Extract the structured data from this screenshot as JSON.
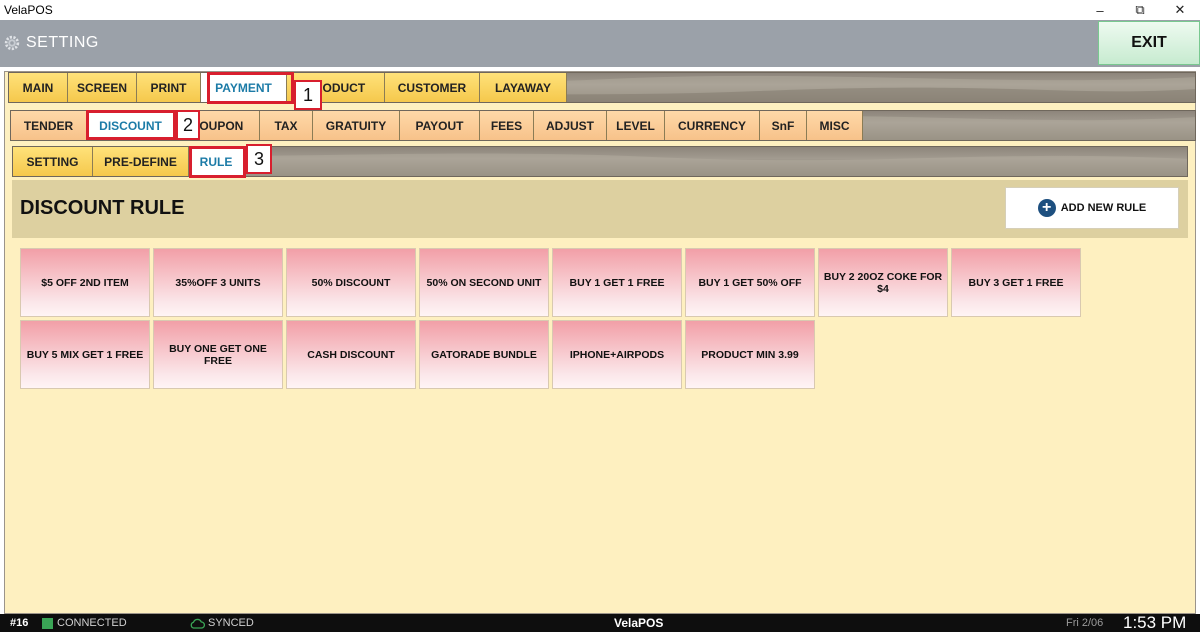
{
  "window": {
    "title": "VelaPOS",
    "controls": {
      "minimize": "–",
      "maximize": "⧉",
      "close": "✕"
    }
  },
  "header": {
    "title": "SETTING",
    "exit_label": "EXIT",
    "icon": "gear-icon"
  },
  "tabs_level1": [
    {
      "label": "MAIN"
    },
    {
      "label": "SCREEN"
    },
    {
      "label": "PRINT"
    },
    {
      "label": "PAYMENT",
      "active": true
    },
    {
      "label": "PRODUCT"
    },
    {
      "label": "CUSTOMER"
    },
    {
      "label": "LAYAWAY"
    }
  ],
  "tabs_level2": [
    {
      "label": "TENDER"
    },
    {
      "label": "DISCOUNT",
      "active": true
    },
    {
      "label": "COUPON"
    },
    {
      "label": "TAX"
    },
    {
      "label": "GRATUITY"
    },
    {
      "label": "PAYOUT"
    },
    {
      "label": "FEES"
    },
    {
      "label": "ADJUST"
    },
    {
      "label": "LEVEL"
    },
    {
      "label": "CURRENCY"
    },
    {
      "label": "SnF"
    },
    {
      "label": "MISC"
    }
  ],
  "tabs_level3": [
    {
      "label": "SETTING"
    },
    {
      "label": "PRE-DEFINE"
    },
    {
      "label": "RULE",
      "active": true
    }
  ],
  "annotations": [
    "1",
    "2",
    "3"
  ],
  "section": {
    "title": "DISCOUNT RULE",
    "add_label": "ADD NEW RULE"
  },
  "rules": [
    "$5 OFF 2ND ITEM",
    "35%OFF 3 UNITS",
    "50% DISCOUNT",
    "50% ON SECOND UNIT",
    "BUY 1 GET 1 FREE",
    "BUY 1 GET 50% OFF",
    "BUY 2 20OZ COKE FOR $4",
    "BUY 3 GET 1 FREE",
    "BUY 5 MIX GET 1 FREE",
    "BUY ONE GET ONE FREE",
    "CASH DISCOUNT",
    "GATORADE BUNDLE",
    "IPHONE+AIRPODS",
    "PRODUCT MIN 3.99"
  ],
  "status": {
    "station": "#16",
    "connected": "CONNECTED",
    "synced": "SYNCED",
    "brand_a": "Vela",
    "brand_b": "POS",
    "date": "Fri 2/06",
    "time": "1:53 PM"
  },
  "colors": {
    "highlight": "#d81f2e",
    "active_tab_text": "#1c7ba7",
    "panel_bg": "#fef0c0"
  }
}
